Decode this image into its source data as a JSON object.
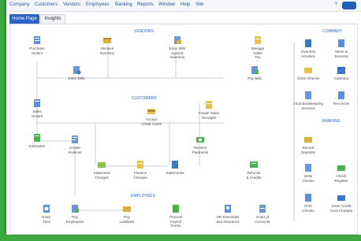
{
  "menu": [
    "Company",
    "Customers",
    "Vendors",
    "Employees",
    "Banking",
    "Reports",
    "Window",
    "Help",
    "Site"
  ],
  "help_label": "?",
  "help_button_label": "",
  "tabs": {
    "home": "Home Page",
    "insights": "Insights"
  },
  "sections": {
    "vendors": "VENDORS",
    "customers": "CUSTOMERS",
    "employees": "EMPLOYEES",
    "company": "COMPANY",
    "banking": "BANKING"
  },
  "nodes": {
    "purchase_orders": "Purchase\nOrders",
    "receive_inventory": "Receive\nInventory",
    "enter_bills_against_inventory": "Enter Bills\nAgainst\nInventory",
    "manage_sales_tax": "Manage\nSales\nTax",
    "enter_bills": "Enter Bills",
    "pay_bills": "Pay Bills",
    "sales_orders": "Sales\nOrders",
    "accept_credit_cards": "Accept\nCredit Cards",
    "create_sales_receipts": "Create Sales\nReceipts",
    "estimates": "Estimates",
    "create_invoices": "Create\nInvoices",
    "receive_payments": "Receive\nPayments",
    "statement_charges": "Statement\nCharges",
    "finance_charges": "Finance\nCharges",
    "statements": "Statements",
    "refunds_credits": "Refunds\n& Credits",
    "enter_time": "Enter\nTime",
    "pay_employees": "Pay\nEmployees",
    "pay_liabilities": "Pay\nLiabilities",
    "process_payroll_forms": "Process\nPayroll\nForms",
    "hr_essentials": "HR Essentials\nand Insurance",
    "chart_of_accounts": "Chart of\nAccounts",
    "inventory_activities": "Inventory\nActivities",
    "items_services": "Items &\nServices",
    "order_checks": "Order Checks",
    "calendar": "Calendar",
    "intuit_bookkeeping": "Intuit Bookkeeping\nServices",
    "record_deposits": "Record\nDeposits",
    "reconcile": "Reconcile",
    "write_checks": "Write\nChecks",
    "check_register": "Check\nRegister",
    "print_checks": "Print\nChecks",
    "enter_credit_card": "Enter Credit\nCard Charges"
  }
}
